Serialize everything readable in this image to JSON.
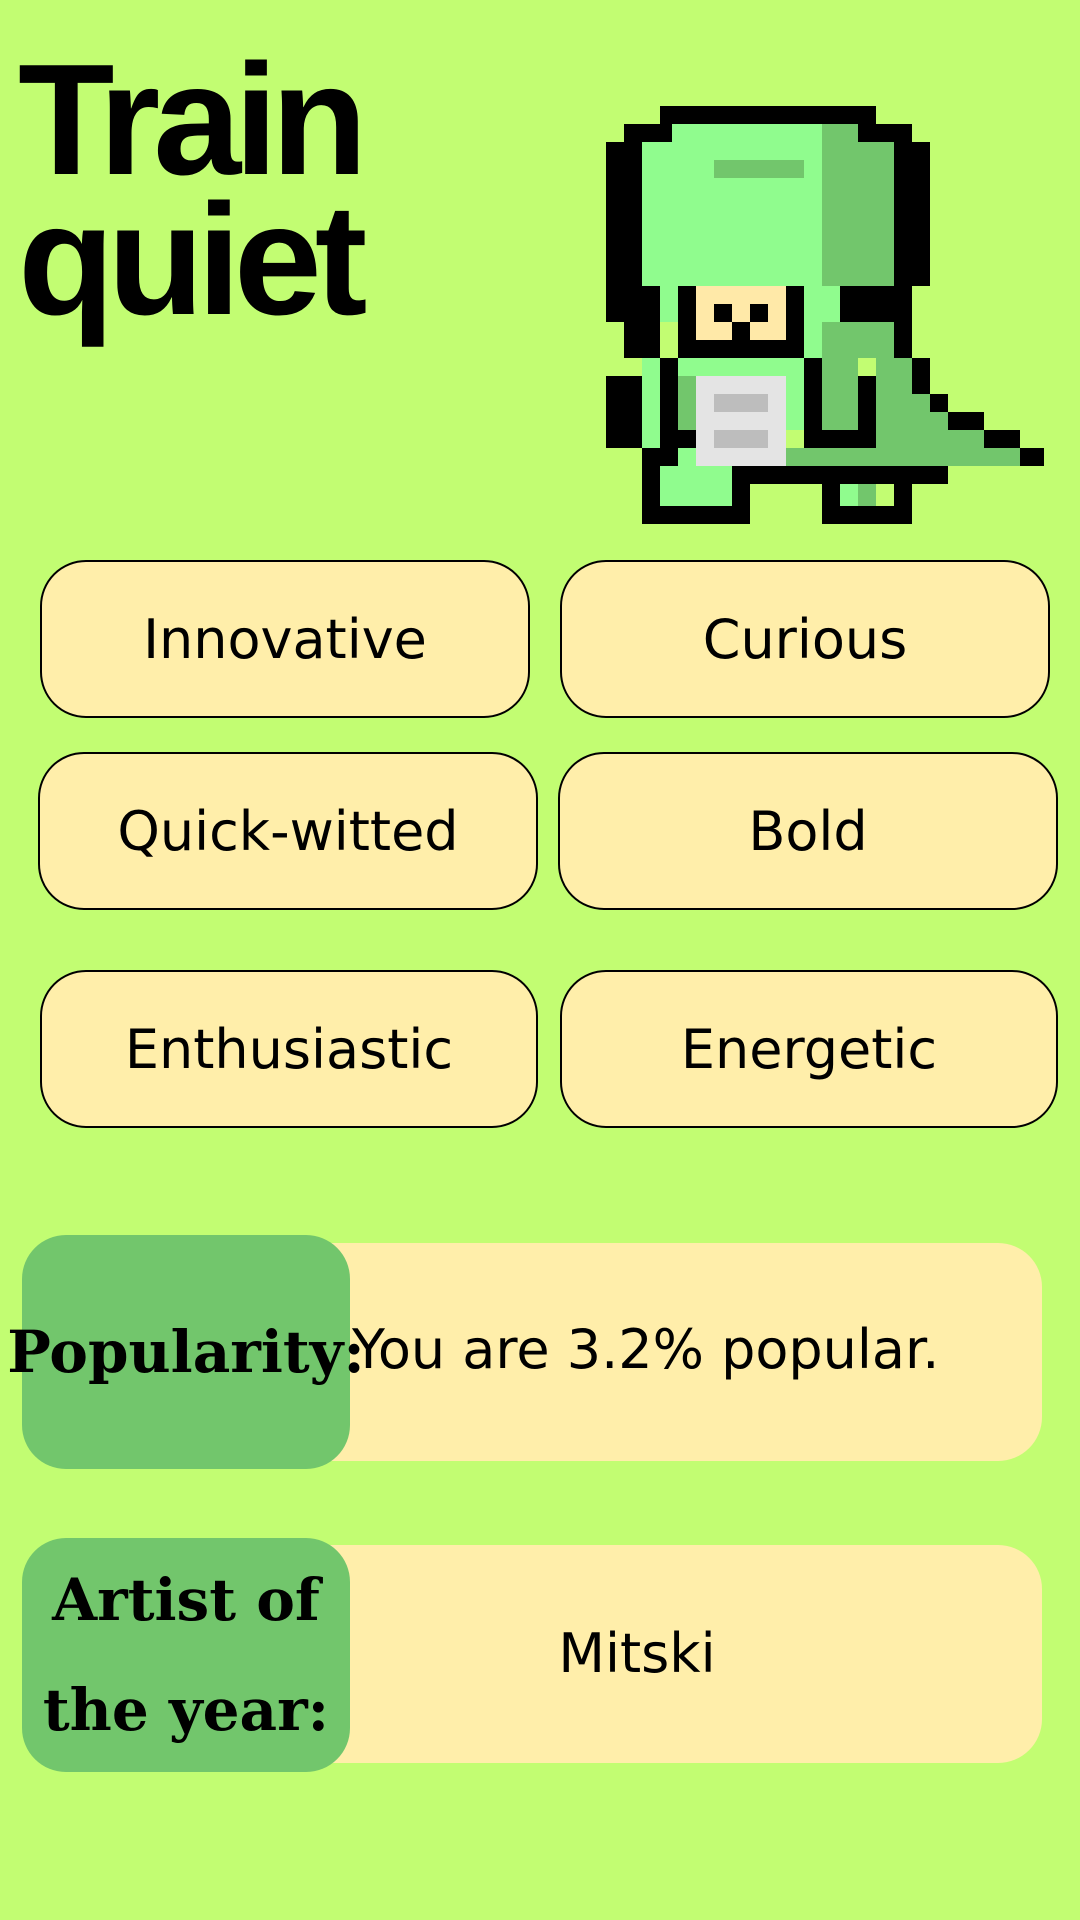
{
  "title": {
    "line1": "Train",
    "line2": "quiet"
  },
  "mascot": {
    "icon": "pixel-dinosaur-icon",
    "colors": {
      "outline": "#000000",
      "light_green": "#90fc8e",
      "dark_green": "#72c66c",
      "belly": "#e4e4e4",
      "face": "#ffe9a8"
    }
  },
  "traits": [
    "Innovative",
    "Curious",
    "Quick-witted",
    "Bold",
    "Enthusiastic",
    "Energetic"
  ],
  "popularity": {
    "label": "Popularity:",
    "value": "You are 3.2% popular."
  },
  "artist": {
    "label": "Artist of the year:",
    "value": "Mitski"
  },
  "colors": {
    "background": "#c2fd72",
    "tag_fill": "#ffeeaa",
    "label_fill": "#72c66c",
    "text": "#000000"
  }
}
